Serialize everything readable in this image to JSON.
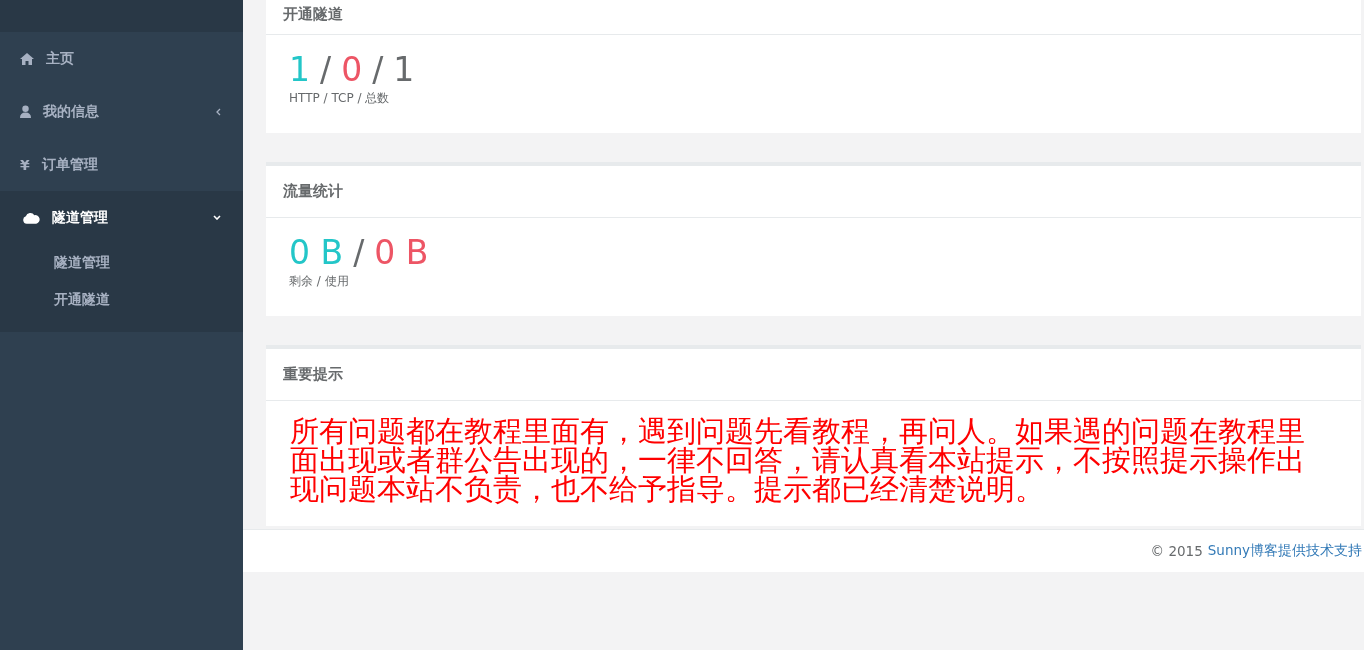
{
  "sidebar": {
    "items": [
      {
        "label": "主页",
        "selected": false
      },
      {
        "label": "我的信息",
        "selected": false,
        "expanded": false
      },
      {
        "label": "订单管理",
        "glyph": "¥",
        "selected": false
      },
      {
        "label": "隧道管理",
        "selected": true,
        "expanded": true,
        "children": [
          {
            "label": "隧道管理"
          },
          {
            "label": "开通隧道"
          }
        ]
      }
    ]
  },
  "cards": [
    {
      "title": "开通隧道",
      "kind": "stats",
      "parts": [
        {
          "text": "1",
          "color": "#23c6c8"
        },
        {
          "text": "/",
          "color": "#676a6c"
        },
        {
          "text": "0",
          "color": "#ed5565"
        },
        {
          "text": "/",
          "color": "#676a6c"
        },
        {
          "text": "1",
          "color": "#676a6c"
        }
      ],
      "caption": "HTTP / TCP / 总数"
    },
    {
      "title": "流量统计",
      "kind": "stats",
      "parts": [
        {
          "text": "0 B",
          "color": "#23c6c8"
        },
        {
          "text": "/",
          "color": "#676a6c"
        },
        {
          "text": "0 B",
          "color": "#ed5565"
        }
      ],
      "caption": "剩余 / 使用"
    },
    {
      "title": "重要提示",
      "kind": "notice",
      "text": "所有问题都在教程里面有，遇到问题先看教程，再问人。如果遇的问题在教程里面出现或者群公告出现的，一律不回答，请认真看本站提示，不按照提示操作出现问题本站不负责，也不给予指导。提示都已经清楚说明。"
    }
  ],
  "footer": {
    "prefix": "© 2015",
    "link": "Sunny博客提供技术支持"
  }
}
